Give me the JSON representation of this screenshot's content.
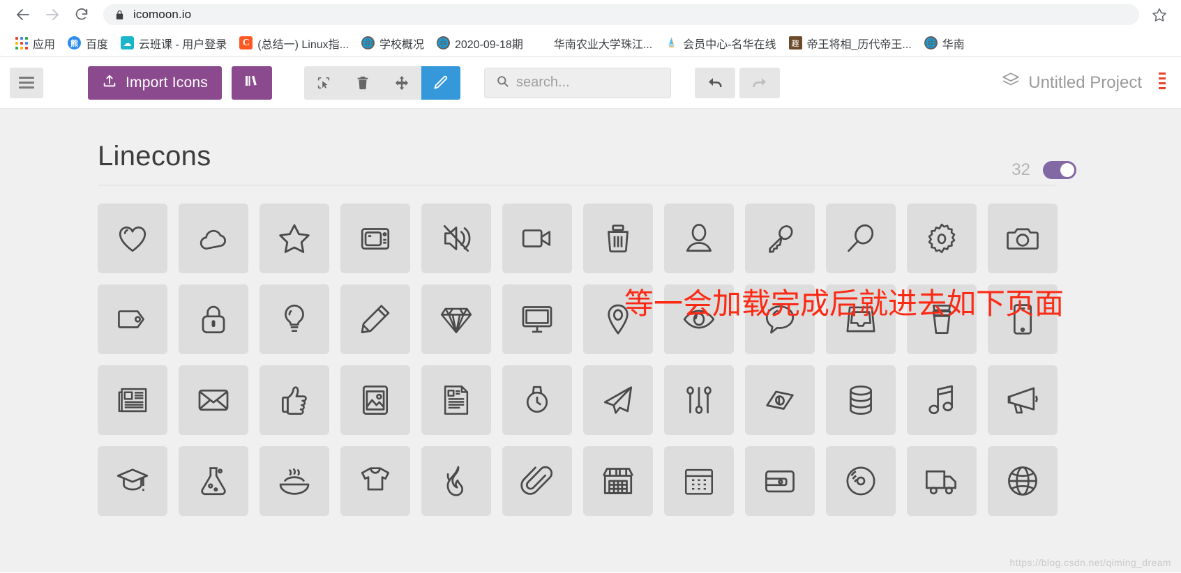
{
  "browser": {
    "url": "icomoon.io",
    "nav": {
      "back": "back-arrow",
      "forward": "forward-arrow",
      "reload": "reload",
      "lock": "lock-icon",
      "star": "bookmark-star"
    },
    "bookmarks": [
      {
        "label": "应用",
        "icon": "apps-grid"
      },
      {
        "label": "百度",
        "icon": "baidu"
      },
      {
        "label": "云班课 - 用户登录",
        "icon": "cloud"
      },
      {
        "label": "(总结一) Linux指...",
        "icon": "csdn-c"
      },
      {
        "label": "学校概况",
        "icon": "globe"
      },
      {
        "label": "2020-09-18期",
        "icon": "globe"
      },
      {
        "label": "华南农业大学珠江...",
        "icon": "blank"
      },
      {
        "label": "会员中心-名华在线",
        "icon": "scau"
      },
      {
        "label": "帝王将相_历代帝王...",
        "icon": "qu"
      },
      {
        "label": "华南",
        "icon": "globe"
      }
    ]
  },
  "toolbar": {
    "menu_label": "menu",
    "import_label": "Import Icons",
    "library_label": "library",
    "tools": [
      {
        "name": "select",
        "active": false
      },
      {
        "name": "delete",
        "active": false
      },
      {
        "name": "move",
        "active": false
      },
      {
        "name": "edit",
        "active": true
      }
    ],
    "search_placeholder": "search...",
    "undo_label": "undo",
    "redo_label": "redo",
    "project_name": "Untitled Project"
  },
  "main": {
    "set_title": "Linecons",
    "set_count": "32",
    "toggle_on": true,
    "icons": [
      "heart",
      "cloud",
      "star",
      "tv",
      "sound-off",
      "video-camera",
      "trash",
      "user",
      "key",
      "search",
      "cog",
      "camera",
      "tag",
      "lock",
      "bulb",
      "pencil",
      "diamond",
      "display",
      "location",
      "eye",
      "bubble",
      "inbox",
      "cup",
      "phone",
      "news",
      "mail",
      "like",
      "photo",
      "note",
      "clock",
      "paper-plane",
      "params",
      "banknote",
      "data",
      "music",
      "megaphone",
      "study",
      "lab",
      "food",
      "t-shirt",
      "fire",
      "clip",
      "shop",
      "calendar",
      "wallet",
      "vinyl",
      "truck",
      "world"
    ]
  },
  "annotation": {
    "text": "等一会加载完成后就进去如下页面",
    "color": "#fc2a14"
  },
  "watermark": "https://blog.csdn.net/qiming_dream",
  "colors": {
    "purple": "#8b4a8e",
    "blue_active": "#3498db",
    "toggle_on": "#8268a5",
    "page_bg": "#f0f0f0",
    "cell_bg": "#dddddd"
  }
}
